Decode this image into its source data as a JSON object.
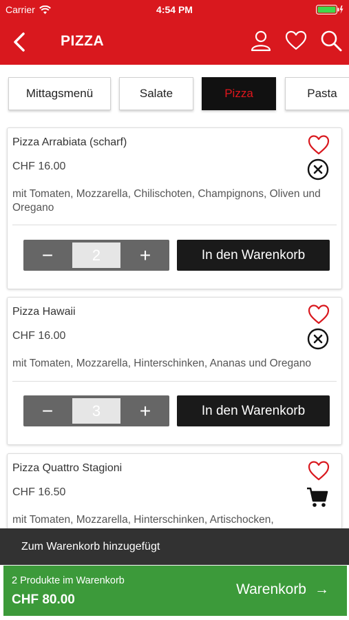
{
  "status_bar": {
    "carrier": "Carrier",
    "time": "4:54 PM"
  },
  "header": {
    "title": "PIZZA",
    "icons": [
      "back-icon",
      "user-icon",
      "heart-icon",
      "search-icon"
    ]
  },
  "tabs": [
    {
      "label": "Mittagsmenü",
      "active": false
    },
    {
      "label": "Salate",
      "active": false
    },
    {
      "label": "Pizza",
      "active": true
    },
    {
      "label": "Pasta",
      "active": false
    }
  ],
  "products": [
    {
      "name": "Pizza Arrabiata (scharf)",
      "price": "CHF 16.00",
      "description": "mit Tomaten, Mozzarella, Chilischoten, Champignons, Oliven und Oregano",
      "quantity": "2",
      "add_label": "In den Warenkorb",
      "status_icon": "remove-circle-icon"
    },
    {
      "name": "Pizza Hawaii",
      "price": "CHF 16.00",
      "description": "mit Tomaten, Mozzarella, Hinterschinken, Ananas und Oregano",
      "quantity": "3",
      "add_label": "In den Warenkorb",
      "status_icon": "remove-circle-icon"
    },
    {
      "name": "Pizza Quattro Stagioni",
      "price": "CHF 16.50",
      "description": "mit Tomaten, Mozzarella, Hinterschinken, Artischocken,",
      "status_icon": "cart-icon"
    }
  ],
  "stepper": {
    "minus": "−",
    "plus": "+"
  },
  "toast": {
    "message": "Zum Warenkorb hinzugefügt"
  },
  "cart_bar": {
    "count_text": "2 Produkte im Warenkorb",
    "total": "CHF 80.00",
    "button_label": "Warenkorb",
    "arrow": "→"
  },
  "colors": {
    "brand_red": "#d9181e",
    "cart_green": "#3c9a3a",
    "toast_bg": "#323232",
    "tab_active_bg": "#111111"
  }
}
